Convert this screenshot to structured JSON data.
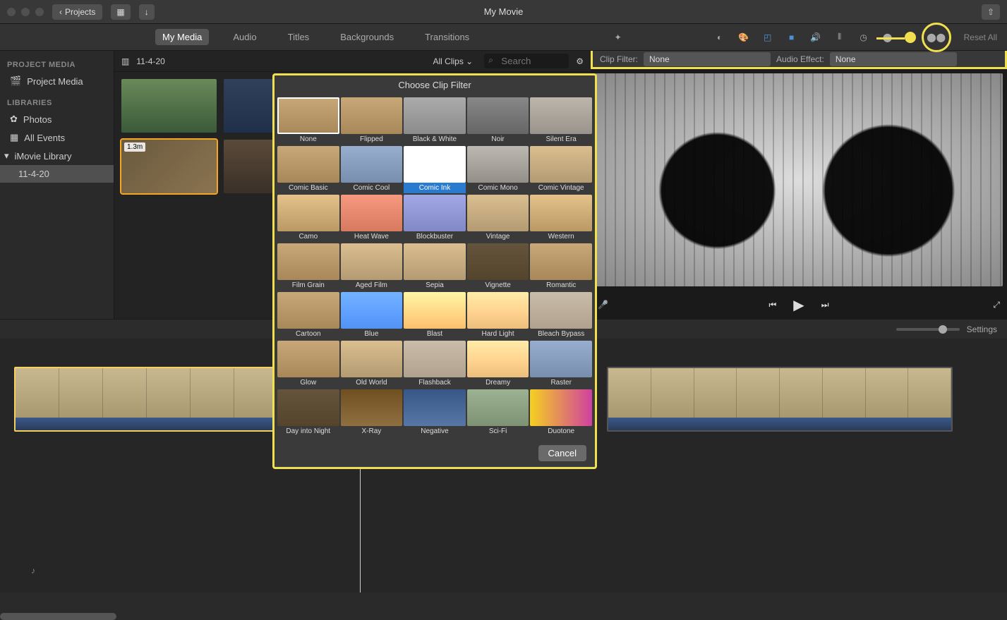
{
  "titlebar": {
    "projects": "Projects",
    "title": "My Movie"
  },
  "tabs": {
    "mymedia": "My Media",
    "audio": "Audio",
    "titles": "Titles",
    "backgrounds": "Backgrounds",
    "transitions": "Transitions"
  },
  "inspector": {
    "reset": "Reset All"
  },
  "sidebar": {
    "project_head": "PROJECT MEDIA",
    "project_item": "Project Media",
    "libraries_head": "LIBRARIES",
    "photos": "Photos",
    "all_events": "All Events",
    "imovie_lib": "iMovie Library",
    "event": "11-4-20"
  },
  "browser": {
    "event_name": "11-4-20",
    "allclips": "All Clips",
    "search_ph": "Search",
    "clip_badge": "1.3m"
  },
  "effects": {
    "clip_label": "Clip Filter:",
    "clip_value": "None",
    "audio_label": "Audio Effect:",
    "audio_value": "None"
  },
  "timeline": {
    "settings": "Settings"
  },
  "modal": {
    "title": "Choose Clip Filter",
    "cancel": "Cancel",
    "filters": [
      "None",
      "Flipped",
      "Black & White",
      "Noir",
      "Silent Era",
      "Comic Basic",
      "Comic Cool",
      "Comic Ink",
      "Comic Mono",
      "Comic Vintage",
      "Camo",
      "Heat Wave",
      "Blockbuster",
      "Vintage",
      "Western",
      "Film Grain",
      "Aged Film",
      "Sepia",
      "Vignette",
      "Romantic",
      "Cartoon",
      "Blue",
      "Blast",
      "Hard Light",
      "Bleach Bypass",
      "Glow",
      "Old World",
      "Flashback",
      "Dreamy",
      "Raster",
      "Day into Night",
      "X-Ray",
      "Negative",
      "Sci-Fi",
      "Duotone"
    ],
    "tints": [
      "",
      "",
      "t-bw",
      "t-noir",
      "t-silent",
      "",
      "t-cool",
      "t-ink",
      "t-mono",
      "t-vint",
      "t-west",
      "t-heat",
      "t-block",
      "t-vint",
      "t-west",
      "",
      "t-vint",
      "t-vint",
      "t-dark",
      "",
      "",
      "t-blue",
      "t-blast",
      "t-hard",
      "t-bb",
      "",
      "t-vint",
      "t-bb",
      "t-hard",
      "t-cool",
      "t-dark",
      "t-xray",
      "t-neg",
      "t-scifi",
      "t-duo"
    ]
  }
}
